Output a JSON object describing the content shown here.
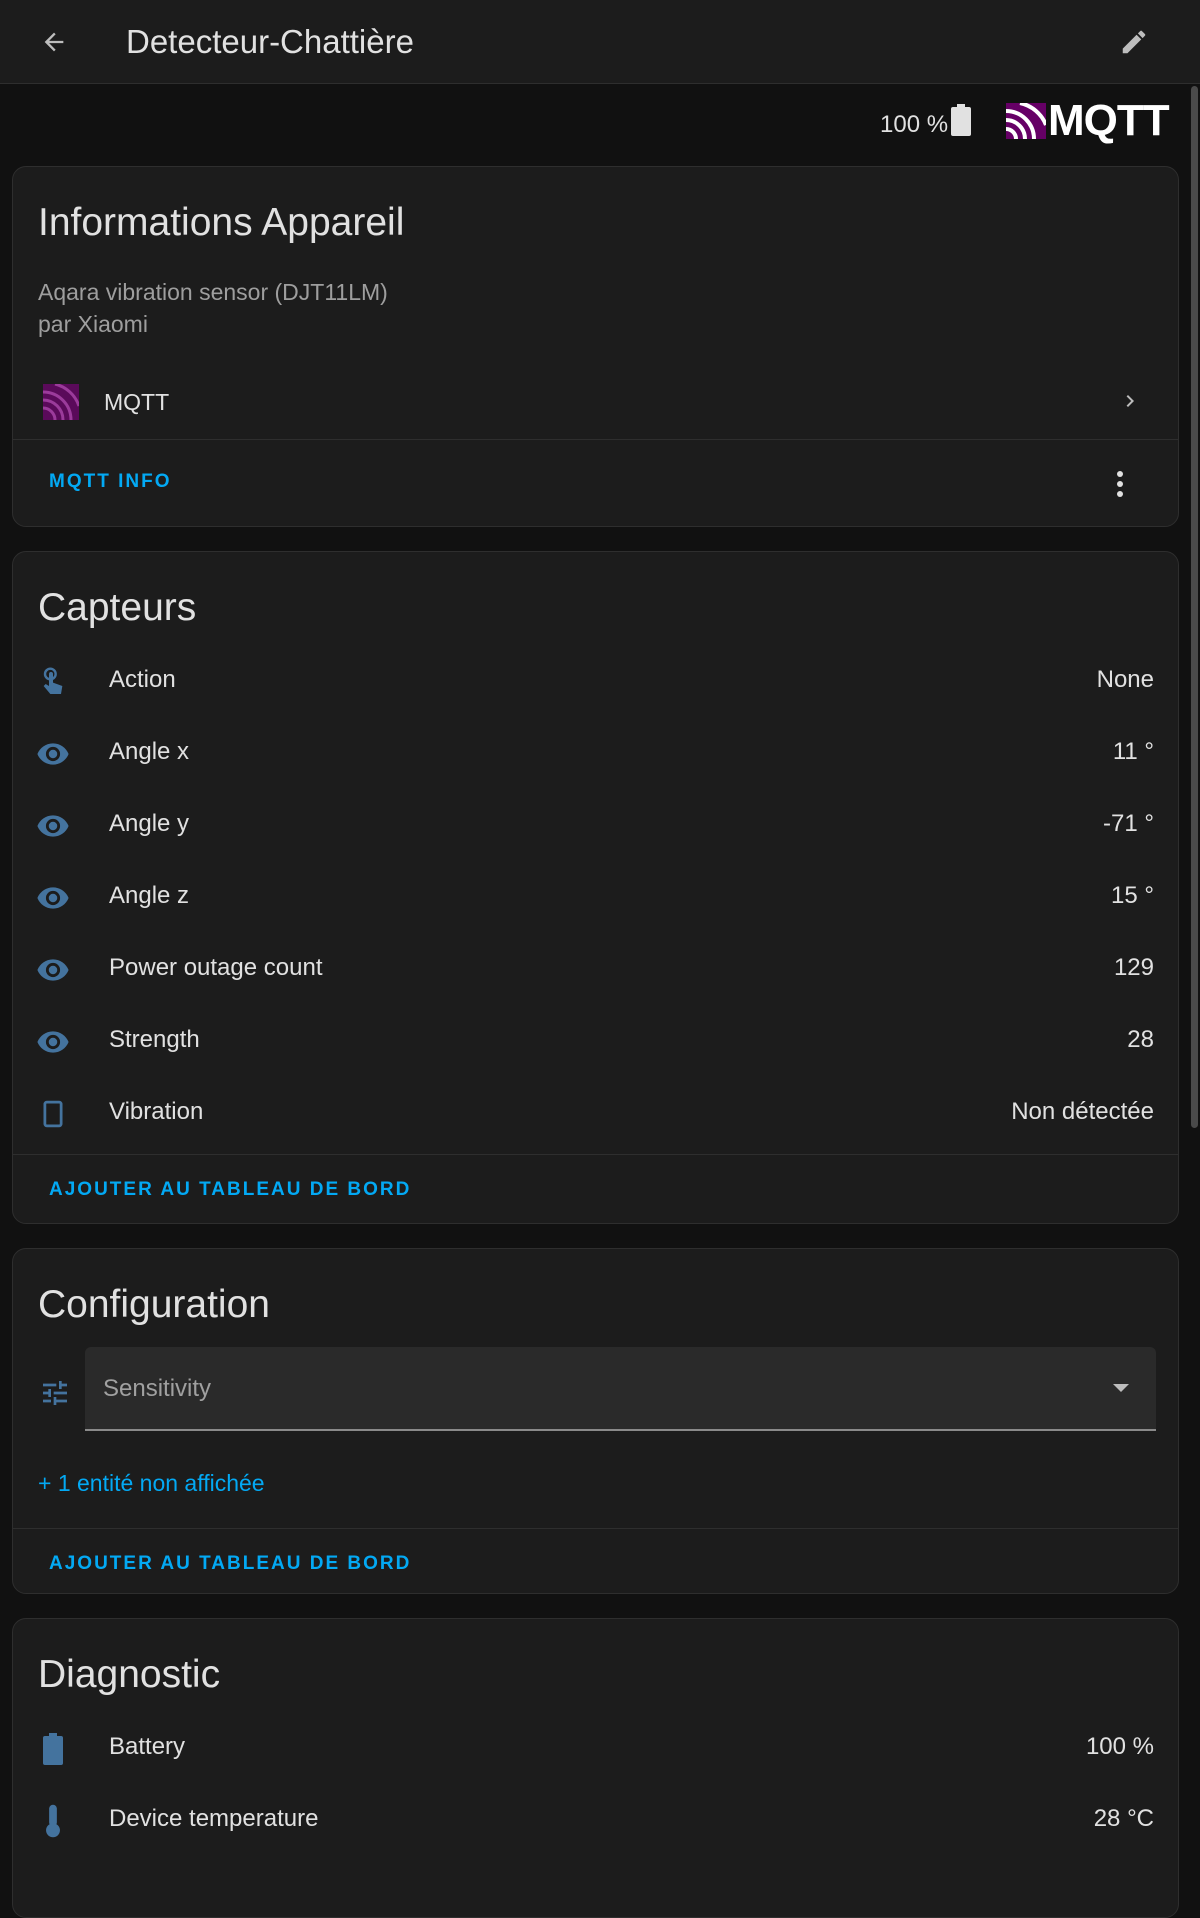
{
  "header": {
    "title": "Detecteur-Chattière"
  },
  "status": {
    "battery_text": "100 %",
    "integration_logo": "MQTT"
  },
  "device_info": {
    "title": "Informations Appareil",
    "model": "Aqara vibration sensor (DJT11LM)",
    "manufacturer": "par Xiaomi",
    "integration_label": "MQTT",
    "action_label": "MQTT INFO"
  },
  "sensors": {
    "title": "Capteurs",
    "items": [
      {
        "icon": "touch-icon",
        "label": "Action",
        "value": "None"
      },
      {
        "icon": "eye-icon",
        "label": "Angle x",
        "value": "11 °"
      },
      {
        "icon": "eye-icon",
        "label": "Angle y",
        "value": "-71 °"
      },
      {
        "icon": "eye-icon",
        "label": "Angle z",
        "value": "15 °"
      },
      {
        "icon": "eye-icon",
        "label": "Power outage count",
        "value": "129"
      },
      {
        "icon": "eye-icon",
        "label": "Strength",
        "value": "28"
      },
      {
        "icon": "vibrate-icon",
        "label": "Vibration",
        "value": "Non détectée"
      }
    ],
    "action_label": "AJOUTER AU TABLEAU DE BORD"
  },
  "configuration": {
    "title": "Configuration",
    "select_label": "Sensitivity",
    "hidden_link": "+ 1 entité non affichée",
    "action_label": "AJOUTER AU TABLEAU DE BORD"
  },
  "diagnostic": {
    "title": "Diagnostic",
    "items": [
      {
        "icon": "battery-icon",
        "label": "Battery",
        "value": "100 %"
      },
      {
        "icon": "thermometer-icon",
        "label": "Device temperature",
        "value": "28 °C"
      }
    ]
  },
  "colors": {
    "accent": "#03a9f4",
    "icon": "#44739e",
    "mqtt_brand": "#660066"
  }
}
